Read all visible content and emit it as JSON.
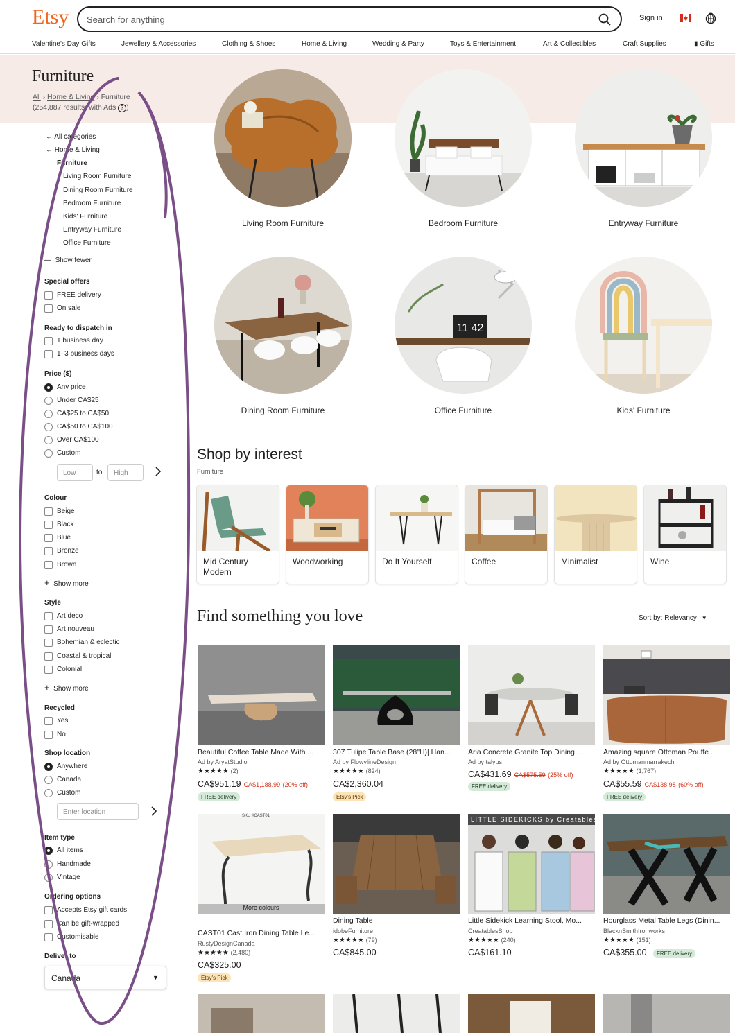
{
  "brand": {
    "logo": "Etsy",
    "accent": "#f1641e"
  },
  "header": {
    "search_placeholder": "Search for anything",
    "sign_in": "Sign in",
    "icons": [
      "search-icon",
      "canada-flag-icon",
      "basket-icon"
    ]
  },
  "categories": [
    "Valentine's Day Gifts",
    "Jewellery & Accessories",
    "Clothing & Shoes",
    "Home & Living",
    "Wedding & Party",
    "Toys & Entertainment",
    "Art & Collectibles",
    "Craft Supplies",
    "Gifts"
  ],
  "page": {
    "title": "Furniture",
    "breadcrumb": [
      "All",
      "Home & Living",
      "Furniture"
    ],
    "results": "(254,887 results, with Ads"
  },
  "sidebar": {
    "nav": [
      "All categories",
      "Home & Living",
      "Furniture"
    ],
    "subnav": [
      "Living Room Furniture",
      "Dining Room Furniture",
      "Bedroom Furniture",
      "Kids' Furniture",
      "Entryway Furniture",
      "Office Furniture"
    ],
    "show_fewer": "Show fewer",
    "special_offers": {
      "title": "Special offers",
      "options": [
        "FREE delivery",
        "On sale"
      ]
    },
    "dispatch": {
      "title": "Ready to dispatch in",
      "options": [
        "1 business day",
        "1–3 business days"
      ]
    },
    "price": {
      "title": "Price ($)",
      "options": [
        "Any price",
        "Under CA$25",
        "CA$25 to CA$50",
        "CA$50 to CA$100",
        "Over CA$100",
        "Custom"
      ],
      "selected": "Any price",
      "low": "Low",
      "to": "to",
      "high": "High"
    },
    "colour": {
      "title": "Colour",
      "options": [
        "Beige",
        "Black",
        "Blue",
        "Bronze",
        "Brown"
      ],
      "show_more": "Show more"
    },
    "style": {
      "title": "Style",
      "options": [
        "Art deco",
        "Art nouveau",
        "Bohemian & eclectic",
        "Coastal & tropical",
        "Colonial"
      ],
      "show_more": "Show more"
    },
    "recycled": {
      "title": "Recycled",
      "options": [
        "Yes",
        "No"
      ]
    },
    "location": {
      "title": "Shop location",
      "options": [
        "Anywhere",
        "Canada",
        "Custom"
      ],
      "selected": "Anywhere",
      "placeholder": "Enter location"
    },
    "item_type": {
      "title": "Item type",
      "options": [
        "All items",
        "Handmade",
        "Vintage"
      ],
      "selected": "All items"
    },
    "ordering": {
      "title": "Ordering options",
      "options": [
        "Accepts Etsy gift cards",
        "Can be gift-wrapped",
        "Customisable"
      ]
    },
    "deliver": {
      "title": "Deliver to",
      "value": "Canada"
    }
  },
  "circles": [
    "Living Room Furniture",
    "Bedroom Furniture",
    "Entryway Furniture",
    "Dining Room Furniture",
    "Office Furniture",
    "Kids' Furniture"
  ],
  "interest": {
    "title": "Shop by interest",
    "subtitle": "Furniture",
    "cards": [
      "Mid Century Modern",
      "Woodworking",
      "Do It Yourself",
      "Coffee",
      "Minimalist",
      "Wine"
    ]
  },
  "listings_header": {
    "title": "Find something you love",
    "sort": "Sort by: Relevancy"
  },
  "listings": [
    {
      "title": "Beautiful Coffee Table Made With ...",
      "shop": "Ad by AryatStudio",
      "stars": "★★★★★",
      "reviews": "(2)",
      "price": "CA$951.19",
      "old": "CA$1,188.99",
      "off": "(20% off)",
      "badge": "FREE delivery"
    },
    {
      "title": "307 Tulipe Table Base (28\"H)| Han...",
      "shop": "Ad by FlowylineDesign",
      "stars": "★★★★★",
      "reviews": "(824)",
      "price": "CA$2,360.04",
      "badge": "Etsy's Pick"
    },
    {
      "title": "Aria Concrete Granite Top Dining ...",
      "shop": "Ad by talyus",
      "price": "CA$431.69",
      "old": "CA$575.59",
      "off": "(25% off)",
      "badge": "FREE delivery"
    },
    {
      "title": "Amazing square Ottoman Pouffe ...",
      "shop": "Ad by Ottomanmarrakech",
      "stars": "★★★★★",
      "reviews": "(1,767)",
      "price": "CA$55.59",
      "old": "CA$138.98",
      "off": "(60% off)",
      "badge": "FREE delivery"
    },
    {
      "title": "CAST01 Cast Iron Dining Table Le...",
      "shop": "RustyDesignCanada",
      "stars": "★★★★★",
      "reviews": "(2,480)",
      "price": "CA$325.00",
      "badge": "Etsy's Pick",
      "overlay": "More colours",
      "sku": "SKU #CAST01"
    },
    {
      "title": "Dining Table",
      "shop": "idobeFurniture",
      "stars": "★★★★★",
      "reviews": "(79)",
      "price": "CA$845.00"
    },
    {
      "title": "Little Sidekick Learning Stool, Mo...",
      "shop": "CreatablesShop",
      "stars": "★★★★★",
      "reviews": "(240)",
      "price": "CA$161.10",
      "banner": "LITTLE SIDEKICKS by Creatables"
    },
    {
      "title": "Hourglass Metal Table Legs (Dinin...",
      "shop": "BlacknSmithIronworks",
      "stars": "★★★★★",
      "reviews": "(151)",
      "price": "CA$355.00",
      "badge": "FREE delivery"
    }
  ]
}
